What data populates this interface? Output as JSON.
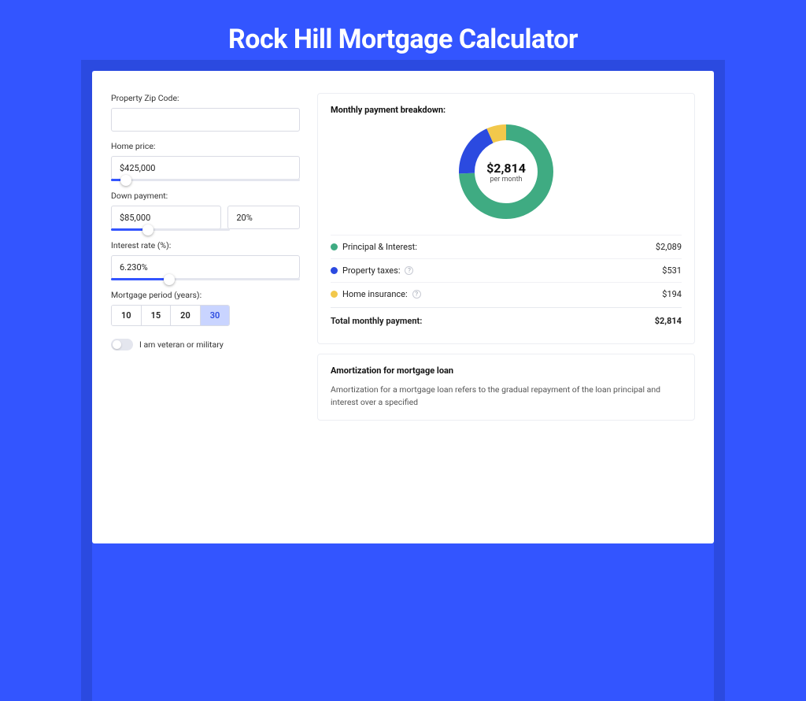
{
  "hero": {
    "title": "Rock Hill Mortgage Calculator"
  },
  "form": {
    "zip_label": "Property Zip Code:",
    "zip_value": "",
    "home_price_label": "Home price:",
    "home_price_value": "$425,000",
    "home_price_slider_pct": 8,
    "down_label": "Down payment:",
    "down_value": "$85,000",
    "down_pct": "20%",
    "down_slider_pct": 20,
    "rate_label": "Interest rate (%):",
    "rate_value": "6.230%",
    "rate_slider_pct": 31,
    "period_label": "Mortgage period (years):",
    "periods": [
      "10",
      "15",
      "20",
      "30"
    ],
    "period_active": "30",
    "vet_label": "I am veteran or military"
  },
  "breakdown": {
    "heading": "Monthly payment breakdown:",
    "total_big": "$2,814",
    "total_sub": "per month",
    "items": [
      {
        "label": "Principal & Interest:",
        "value": "$2,089",
        "color": "#3fab82",
        "info": false
      },
      {
        "label": "Property taxes:",
        "value": "$531",
        "color": "#2b4ae0",
        "info": true
      },
      {
        "label": "Home insurance:",
        "value": "$194",
        "color": "#f2c84b",
        "info": true
      }
    ],
    "total_label": "Total monthly payment:",
    "total_value": "$2,814"
  },
  "amort": {
    "heading": "Amortization for mortgage loan",
    "body": "Amortization for a mortgage loan refers to the gradual repayment of the loan principal and interest over a specified"
  },
  "chart_data": {
    "type": "pie",
    "title": "Monthly payment breakdown",
    "series": [
      {
        "name": "Principal & Interest",
        "value": 2089,
        "color": "#3fab82"
      },
      {
        "name": "Property taxes",
        "value": 531,
        "color": "#2b4ae0"
      },
      {
        "name": "Home insurance",
        "value": 194,
        "color": "#f2c84b"
      }
    ],
    "total": 2814,
    "center_label": "$2,814 per month"
  }
}
